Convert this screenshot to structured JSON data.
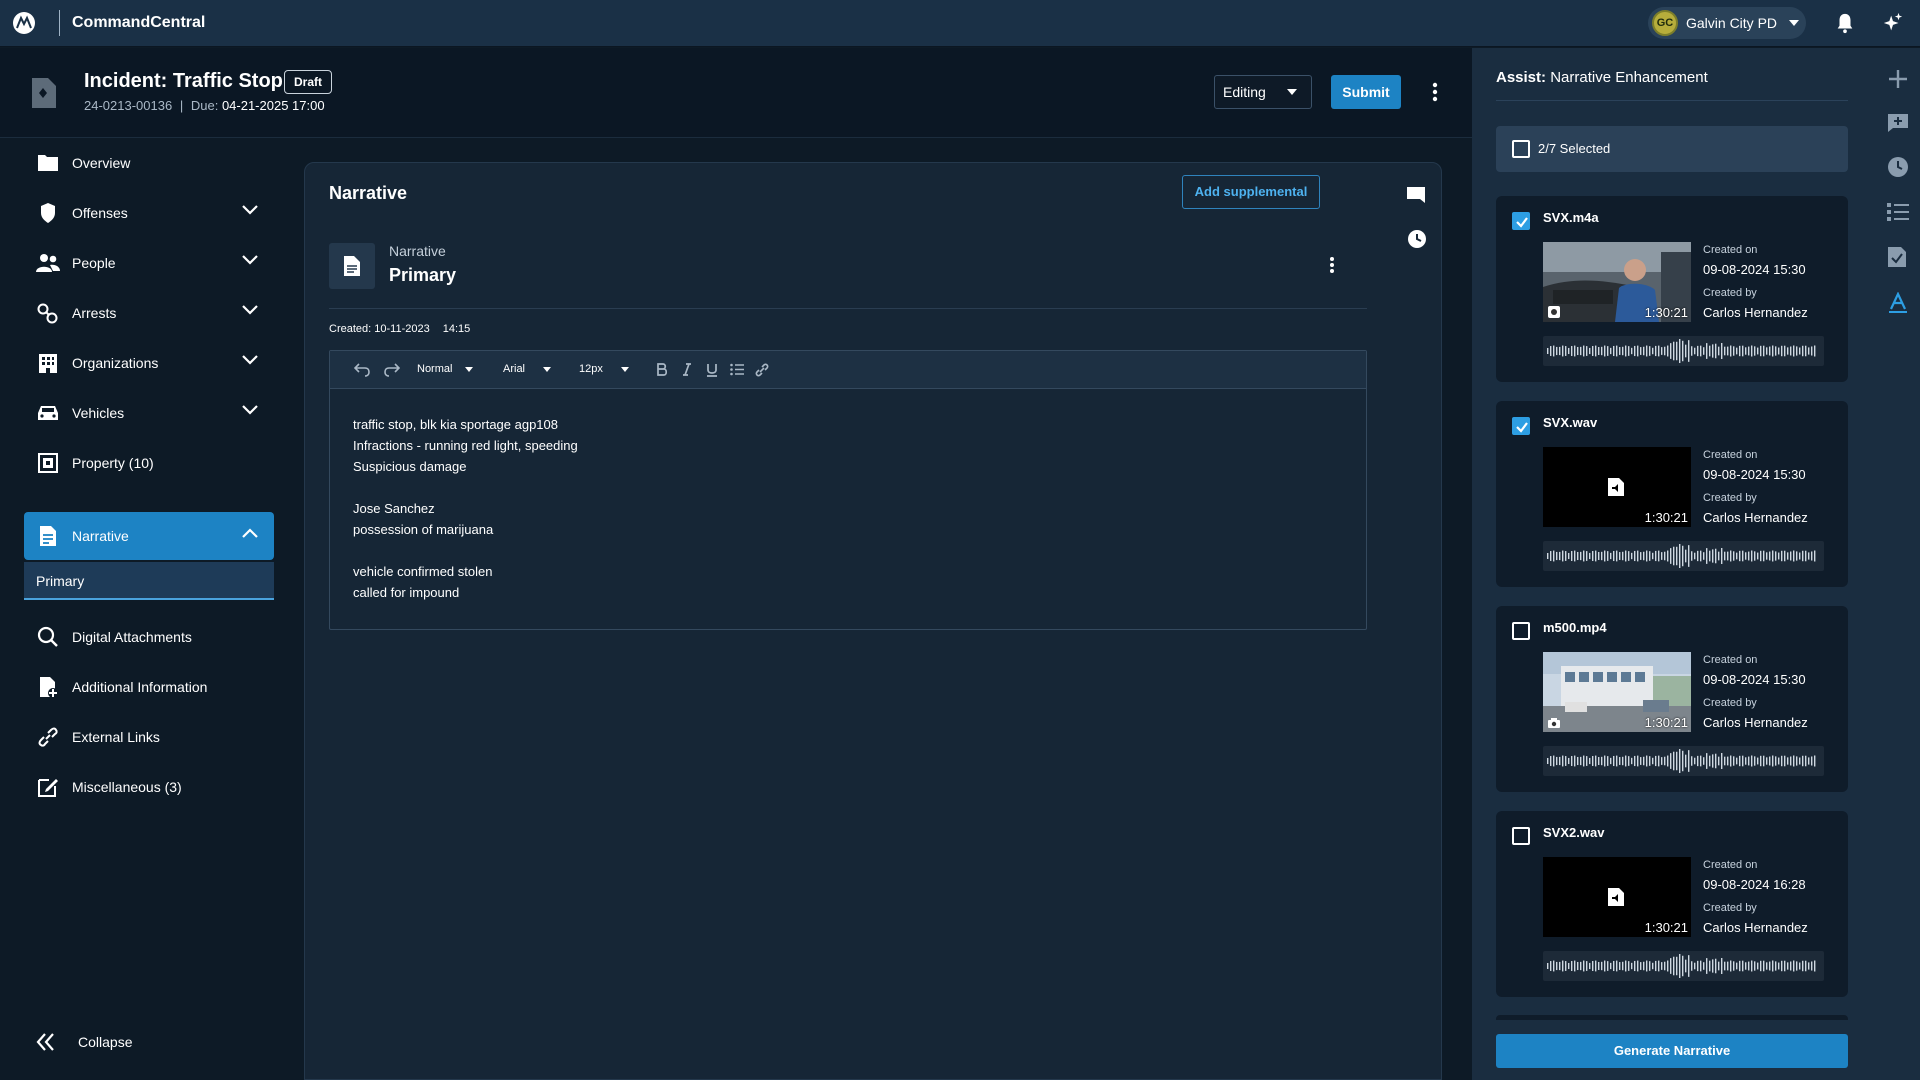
{
  "app": {
    "title": "CommandCentral",
    "agency": "Galvin City PD",
    "avatar_initials": "GC"
  },
  "header": {
    "title": "Incident: Traffic Stop",
    "status_badge": "Draft",
    "incident_number": "24-0213-00136",
    "separator": "|",
    "due_label": "Due:",
    "due_value": "04-21-2025 17:00",
    "mode": "Editing",
    "submit_label": "Submit"
  },
  "sidebar": {
    "items": [
      {
        "label": "Overview",
        "icon": "folder-icon",
        "expandable": false
      },
      {
        "label": "Offenses",
        "icon": "badge-icon",
        "expandable": true
      },
      {
        "label": "People",
        "icon": "people-icon",
        "expandable": true
      },
      {
        "label": "Arrests",
        "icon": "handcuffs-icon",
        "expandable": true
      },
      {
        "label": "Organizations",
        "icon": "building-icon",
        "expandable": true
      },
      {
        "label": "Vehicles",
        "icon": "car-icon",
        "expandable": true
      },
      {
        "label": "Property (10)",
        "icon": "property-icon",
        "expandable": false
      },
      {
        "label": "Narrative",
        "icon": "document-icon",
        "expandable": true,
        "active": true
      },
      {
        "label": "Digital Attachments",
        "icon": "search-icon",
        "expandable": false
      },
      {
        "label": "Additional Information",
        "icon": "file-add-icon",
        "expandable": false
      },
      {
        "label": "External Links",
        "icon": "link-icon",
        "expandable": false
      },
      {
        "label": "Miscellaneous (3)",
        "icon": "edit-icon",
        "expandable": false
      }
    ],
    "sub_item": "Primary",
    "collapse_label": "Collapse"
  },
  "main": {
    "title": "Narrative",
    "add_supplemental": "Add supplemental",
    "narrative_caption": "Narrative",
    "narrative_name": "Primary",
    "created": "Created: 10-11-2023",
    "created_time": "14:15",
    "toolbar": {
      "style": "Normal",
      "font": "Arial",
      "size": "12px"
    },
    "body_lines": [
      "traffic stop, blk kia sportage agp108",
      "Infractions - running red light, speeding",
      "Suspicious damage",
      "",
      "Jose Sanchez",
      "possession of marijuana",
      "",
      "vehicle confirmed stolen",
      "called for impound"
    ]
  },
  "assist": {
    "title_prefix": "Assist:",
    "title": "Narrative Enhancement",
    "selected": "2/7 Selected",
    "created_on_label": "Created on",
    "created_by_label": "Created by",
    "files": [
      {
        "name": "SVX.m4a",
        "checked": true,
        "thumb": "bodycam",
        "duration": "1:30:21",
        "created_on": "09-08-2024 15:30",
        "created_by": "Carlos Hernandez"
      },
      {
        "name": "SVX.wav",
        "checked": true,
        "thumb": "audio",
        "duration": "1:30:21",
        "created_on": "09-08-2024 15:30",
        "created_by": "Carlos Hernandez"
      },
      {
        "name": "m500.mp4",
        "checked": false,
        "thumb": "building",
        "duration": "1:30:21",
        "created_on": "09-08-2024 15:30",
        "created_by": "Carlos Hernandez"
      },
      {
        "name": "SVX2.wav",
        "checked": false,
        "thumb": "audio",
        "duration": "1:30:21",
        "created_on": "09-08-2024 16:28",
        "created_by": "Carlos Hernandez"
      }
    ],
    "generate_label": "Generate Narrative"
  },
  "colors": {
    "accent": "#1d83c4",
    "active_check": "#2d9ee3",
    "link": "#4eb2f0"
  }
}
